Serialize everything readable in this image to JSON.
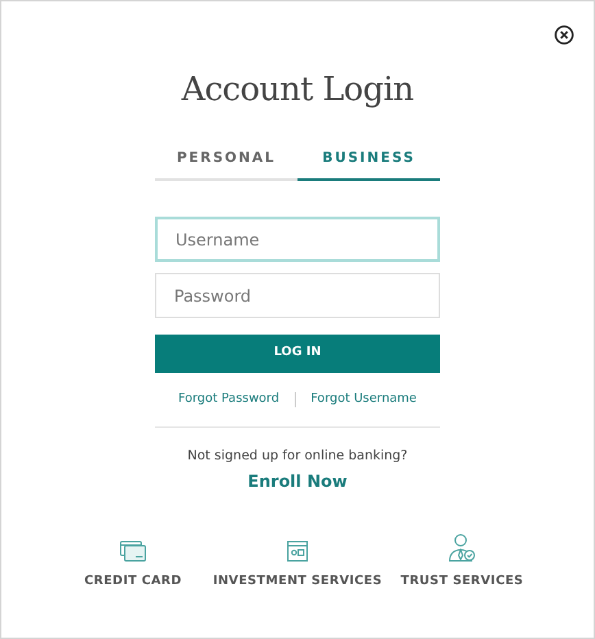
{
  "title": "Account Login",
  "tabs": [
    {
      "label": "PERSONAL",
      "selected": false
    },
    {
      "label": "BUSINESS",
      "selected": true
    }
  ],
  "fields": [
    {
      "placeholder": "Username",
      "focused": true
    },
    {
      "placeholder": "Password",
      "focused": false
    }
  ],
  "login_button": "LOG IN",
  "links": [
    "Forgot Password",
    "Forgot Username"
  ],
  "enroll_prompt": "Not signed up for online banking?",
  "enroll_link": "Enroll Now",
  "services": [
    {
      "kind": "card",
      "label": "CREDIT CARD"
    },
    {
      "kind": "investment",
      "label": "INVESTMENT SERVICES"
    },
    {
      "kind": "trust",
      "label": "TRUST SERVICES"
    }
  ]
}
